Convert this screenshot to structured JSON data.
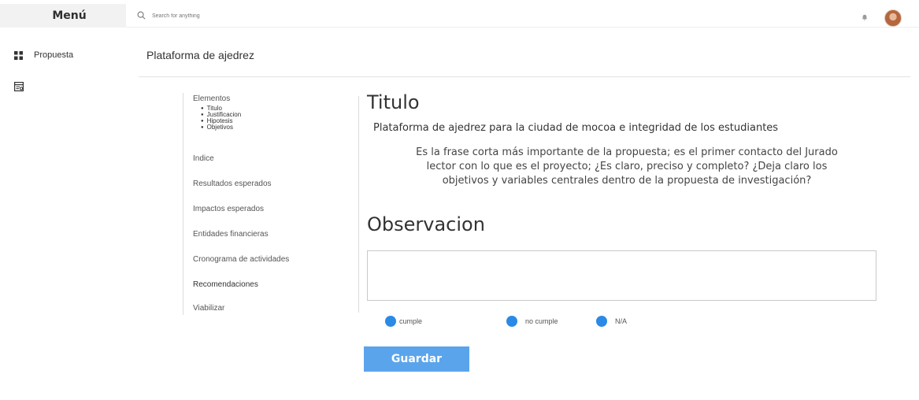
{
  "topbar": {
    "menu_label": "Menú",
    "search_placeholder": "Search for anything",
    "icons": {
      "search": "search-icon",
      "notifications": "bell-icon",
      "avatar": "user-avatar"
    }
  },
  "sidebar": {
    "items": [
      {
        "label": "Propuesta",
        "icon": "grid-icon"
      },
      {
        "label": "",
        "icon": "document-icon"
      }
    ]
  },
  "page": {
    "title": "Plataforma de ajedrez"
  },
  "nav": {
    "elementos": "Elementos",
    "subitems": [
      "Titulo",
      "Justificacion",
      "Hipotesis",
      "Objetivos"
    ],
    "items": [
      "Indice",
      "Resultados esperados",
      "Impactos esperados",
      "Entidades financieras",
      "Cronograma de actividades",
      "Recomendaciones",
      "Viabilizar"
    ]
  },
  "main": {
    "title": "Titulo",
    "subtitle": "Plataforma de ajedrez para la ciudad de mocoa e integridad de los estudiantes",
    "description_lines": [
      "Es la frase corta más importante de la propuesta; es el primer contacto del Jurado",
      "lector con lo que es el proyecto; ¿Es claro, preciso y completo? ¿Deja claro los",
      "objetivos y variables centrales dentro de la propuesta de investigación?"
    ],
    "observation_heading": "Observacion",
    "observation_value": "",
    "options": [
      "cumple",
      "no cumple",
      "N/A"
    ],
    "save_label": "Guardar"
  },
  "colors": {
    "accent": "#2a8ae6",
    "button": "#5aa4ec",
    "menu_bg": "#f2f2f2"
  }
}
